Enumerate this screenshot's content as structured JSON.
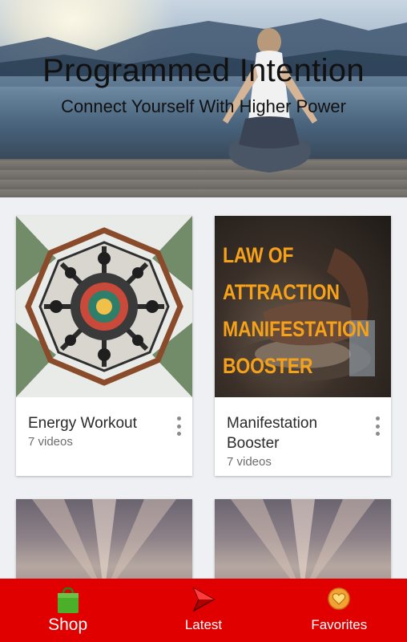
{
  "header": {
    "title": "Programmed Intention",
    "subtitle": "Connect Yourself With Higher Power"
  },
  "playlists": [
    {
      "title": "Energy Workout",
      "count": "7 videos",
      "image": "kaleidoscope-mandala"
    },
    {
      "title": "Manifestation Booster",
      "count": "7 videos",
      "image": "law-of-attraction-poster",
      "image_text": [
        "LAW OF ATTRACTION",
        "MANIFESTATION",
        "BOOSTER"
      ]
    },
    {
      "title": "",
      "count": "",
      "image": "fractal-feather"
    },
    {
      "title": "",
      "count": "",
      "image": "fractal-feather"
    }
  ],
  "bottom_nav": [
    {
      "label": "Shop",
      "icon": "shopping-bag-icon"
    },
    {
      "label": "Latest",
      "icon": "play-arrow-icon"
    },
    {
      "label": "Favorites",
      "icon": "heart-badge-icon"
    }
  ],
  "colors": {
    "nav_bg": "#e00000",
    "accent_text": "#f6a11a"
  }
}
